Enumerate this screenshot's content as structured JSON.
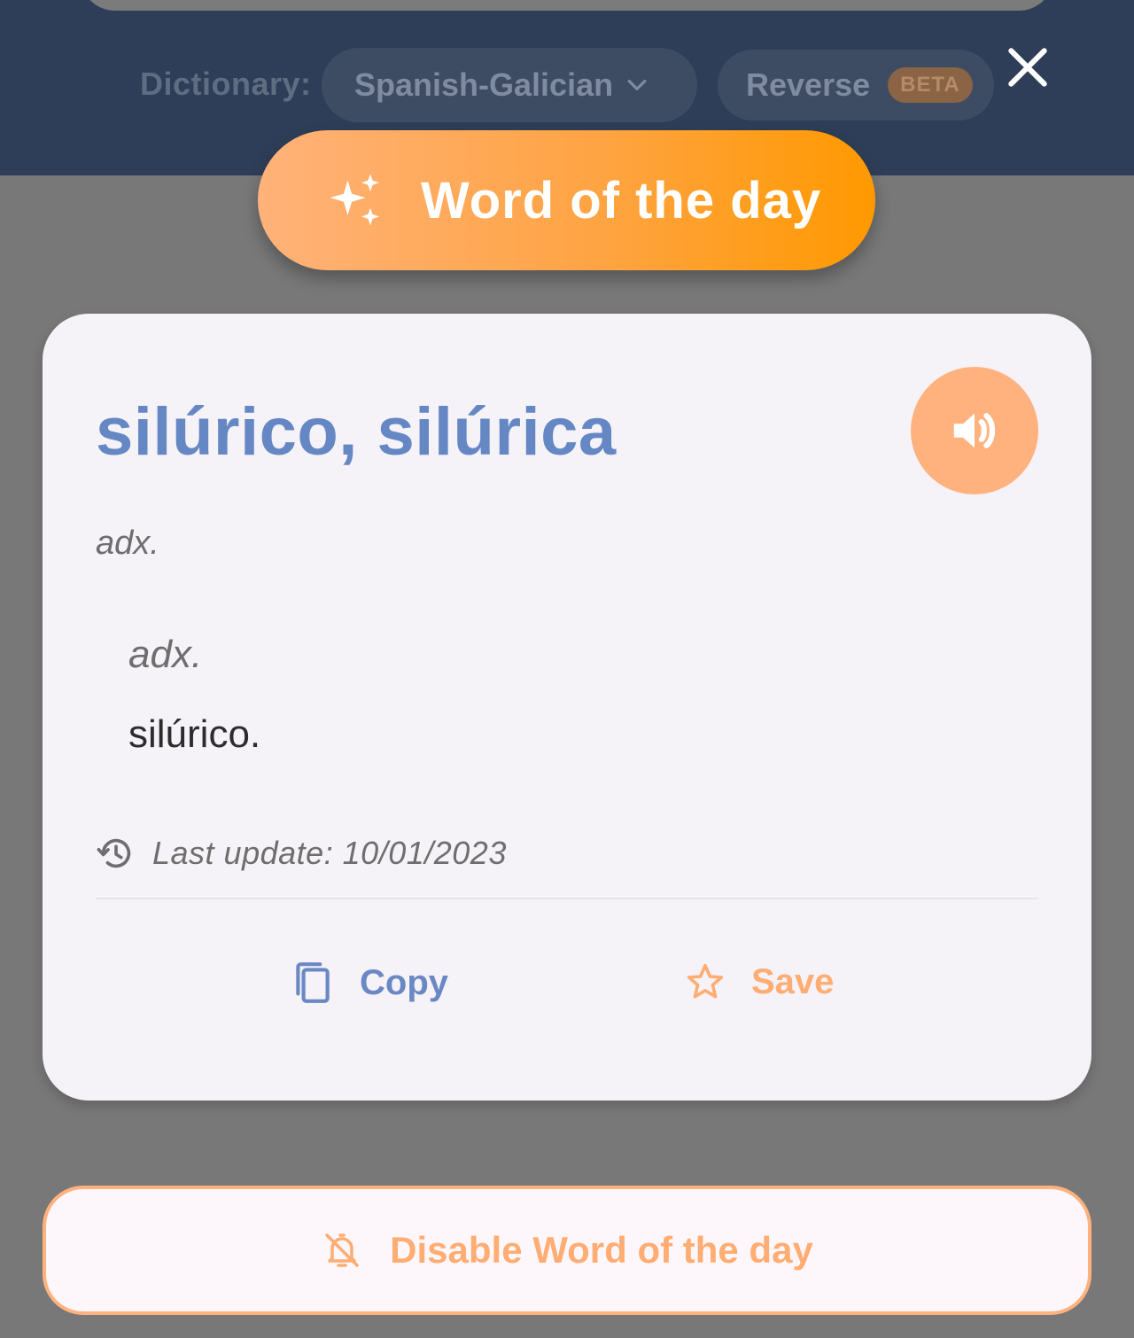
{
  "header": {
    "dictionary_label": "Dictionary:",
    "dictionary_selected": "Spanish-Galician",
    "reverse_label": "Reverse",
    "beta_badge": "BETA",
    "close_icon": "close-icon"
  },
  "banner": {
    "title": "Word of the day",
    "icon": "sparkles-icon"
  },
  "card": {
    "headword": "silúrico, silúrica",
    "audio_icon": "speaker-icon",
    "part_of_speech": "adx.",
    "senses": [
      {
        "pos": "adx.",
        "definition": "silúrico."
      }
    ],
    "last_update": "Last update: 10/01/2023",
    "copy_label": "Copy",
    "save_label": "Save"
  },
  "footer": {
    "disable_label": "Disable Word of the day",
    "disable_icon": "bell-off-icon"
  },
  "colors": {
    "header_bg": "#2f3e58",
    "accent_orange": "#ffad73",
    "accent_blue": "#6587c3",
    "card_bg": "#f5f2f8",
    "overlay": "#787878"
  }
}
